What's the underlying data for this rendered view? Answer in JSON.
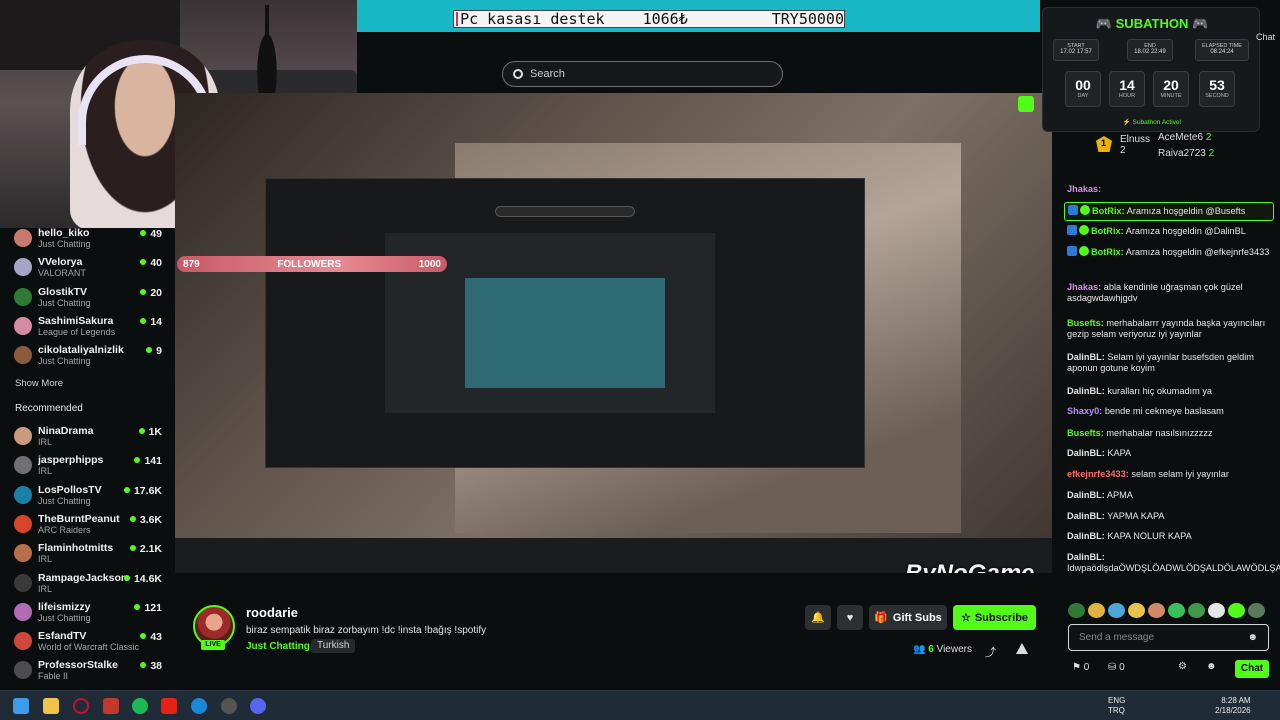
{
  "banner": {
    "donation_label": "Pc kasası destek",
    "current_amount": "1066₺",
    "goal": "TRY50000"
  },
  "search": {
    "placeholder": "Search"
  },
  "followers_goal": {
    "current": "879",
    "label": "FOLLOWERS",
    "target": "1000"
  },
  "sidebar": {
    "following": [
      {
        "name": "hello_kiko",
        "category": "Just Chatting",
        "viewers": "49",
        "color": "#c77a6d"
      },
      {
        "name": "VVelorya",
        "category": "VALORANT",
        "viewers": "40",
        "color": "#a9a3c6"
      },
      {
        "name": "GlostikTV",
        "category": "Just Chatting",
        "viewers": "20",
        "color": "#2f7a35"
      },
      {
        "name": "SashimiSakura",
        "category": "League of Legends",
        "viewers": "14",
        "color": "#d48ba3"
      },
      {
        "name": "cikolataliyalnizlik",
        "category": "Just Chatting",
        "viewers": "9",
        "color": "#8a5c3d"
      }
    ],
    "show_more": "Show More",
    "recommended_title": "Recommended",
    "recommended": [
      {
        "name": "NinaDrama",
        "category": "IRL",
        "viewers": "1K",
        "color": "#c99a7c"
      },
      {
        "name": "jasperphipps",
        "category": "IRL",
        "viewers": "141",
        "color": "#707070"
      },
      {
        "name": "LosPollosTV",
        "category": "Just Chatting",
        "viewers": "17.6K",
        "color": "#1b7fa8"
      },
      {
        "name": "TheBurntPeanut",
        "category": "ARC Raiders",
        "viewers": "3.6K",
        "color": "#d9452b"
      },
      {
        "name": "Flaminhotmitts",
        "category": "IRL",
        "viewers": "2.1K",
        "color": "#b96f4a"
      },
      {
        "name": "RampageJackson",
        "category": "IRL",
        "viewers": "14.6K",
        "color": "#3a3a3a"
      },
      {
        "name": "lifeismizzy",
        "category": "Just Chatting",
        "viewers": "121",
        "color": "#b06db3"
      },
      {
        "name": "EsfandTV",
        "category": "World of Warcraft Classic",
        "viewers": "43",
        "color": "#d0473b"
      },
      {
        "name": "ProfessorStalke",
        "category": "Fable II",
        "viewers": "38",
        "color": "#4d4d4d"
      }
    ]
  },
  "stream": {
    "name": "roodarie",
    "title": "biraz sempatik biraz zorbayım !dc !insta !bağış !spotify",
    "category": "Just Chatting",
    "language": "Turkish",
    "live": "LIVE",
    "gift_label": "Gift Subs",
    "subscribe_label": "Subscribe",
    "viewers_count": "6",
    "viewers_label": "Viewers"
  },
  "subathon": {
    "title": "SUBATHON",
    "start_label": "START",
    "start_value": "17.02 17:57",
    "end_label": "END",
    "end_value": "18.02 22:49",
    "elapsed_label": "ELAPSED TIME",
    "elapsed_value": "08:24:24",
    "timer": [
      {
        "value": "00",
        "unit": "DAY"
      },
      {
        "value": "14",
        "unit": "HOUR"
      },
      {
        "value": "20",
        "unit": "MINUTE"
      },
      {
        "value": "53",
        "unit": "SECOND"
      }
    ],
    "active_text": "Subathon Active!"
  },
  "leaderboard": {
    "rank": "1",
    "top_name": "Elnuss",
    "top_count": "2",
    "second": "AceMete6",
    "second_count": "2",
    "third": "Raiva2723",
    "third_count": "2"
  },
  "chat": {
    "top_label": "Chat",
    "messages": [
      {
        "user": "Jhakas:",
        "text": "",
        "color": "#d88ce8",
        "highlight": false,
        "bot": false
      },
      {
        "user": "BotRix:",
        "text": "Aramıza hoşgeldin @Busefts",
        "color": "#53fc18",
        "highlight": true,
        "bot": true
      },
      {
        "user": "BotRix:",
        "text": "Aramıza hoşgeldin @DalinBL",
        "color": "#53fc18",
        "highlight": false,
        "bot": true
      },
      {
        "user": "BotRix:",
        "text": "Aramıza hoşgeldin @efkejnrfe3433",
        "color": "#53fc18",
        "highlight": false,
        "bot": true
      },
      {
        "user": "Jhakas:",
        "text": "abla kendinle uğraşman çok güzel asdagwdawhjgdv",
        "color": "#d88ce8",
        "highlight": false,
        "bot": false
      },
      {
        "user": "Busefts:",
        "text": "merhabalarrr yayında başka yayıncıları gezip selam veriyoruz iyi yayınlar",
        "color": "#53fc18",
        "highlight": false,
        "bot": false
      },
      {
        "user": "DalinBL:",
        "text": "Selam iyi yayınlar busefsden geldim aponun gotune koyim",
        "color": "#e6e6e6",
        "highlight": false,
        "bot": false
      },
      {
        "user": "DalinBL:",
        "text": "kuralları hiç okumadım ya",
        "color": "#e6e6e6",
        "highlight": false,
        "bot": false
      },
      {
        "user": "Shaxy0:",
        "text": "bende mi cekmeye baslasam",
        "color": "#b98cff",
        "highlight": false,
        "bot": false
      },
      {
        "user": "Busefts:",
        "text": "merhabalar nasılsınızzzzz",
        "color": "#53fc18",
        "highlight": false,
        "bot": false
      },
      {
        "user": "DalinBL:",
        "text": "KAPA",
        "color": "#e6e6e6",
        "highlight": false,
        "bot": false
      },
      {
        "user": "efkejnrfe3433:",
        "text": "selam selam iyi yayınlar",
        "color": "#ff6b6b",
        "highlight": false,
        "bot": false
      },
      {
        "user": "DalinBL:",
        "text": "APMA",
        "color": "#e6e6e6",
        "highlight": false,
        "bot": false
      },
      {
        "user": "DalinBL:",
        "text": "YAPMA KAPA",
        "color": "#e6e6e6",
        "highlight": false,
        "bot": false
      },
      {
        "user": "DalinBL:",
        "text": "KAPA NOLUR KAPA",
        "color": "#e6e6e6",
        "highlight": false,
        "bot": false
      },
      {
        "user": "DalinBL:",
        "text": "IdwpaödlşdaÖWDŞLÖADWLÖDŞALDÖLAWÖDLŞAW",
        "color": "#e6e6e6",
        "highlight": false,
        "bot": false
      }
    ],
    "input_placeholder": "Send a message",
    "points_a": "0",
    "points_b": "0",
    "send_label": "Chat"
  },
  "overlay_watermark": "ByNoGame",
  "taskbar": {
    "lang_1": "ENG",
    "lang_2": "TRQ",
    "time": "8:28 AM",
    "date": "2/18/2026"
  }
}
